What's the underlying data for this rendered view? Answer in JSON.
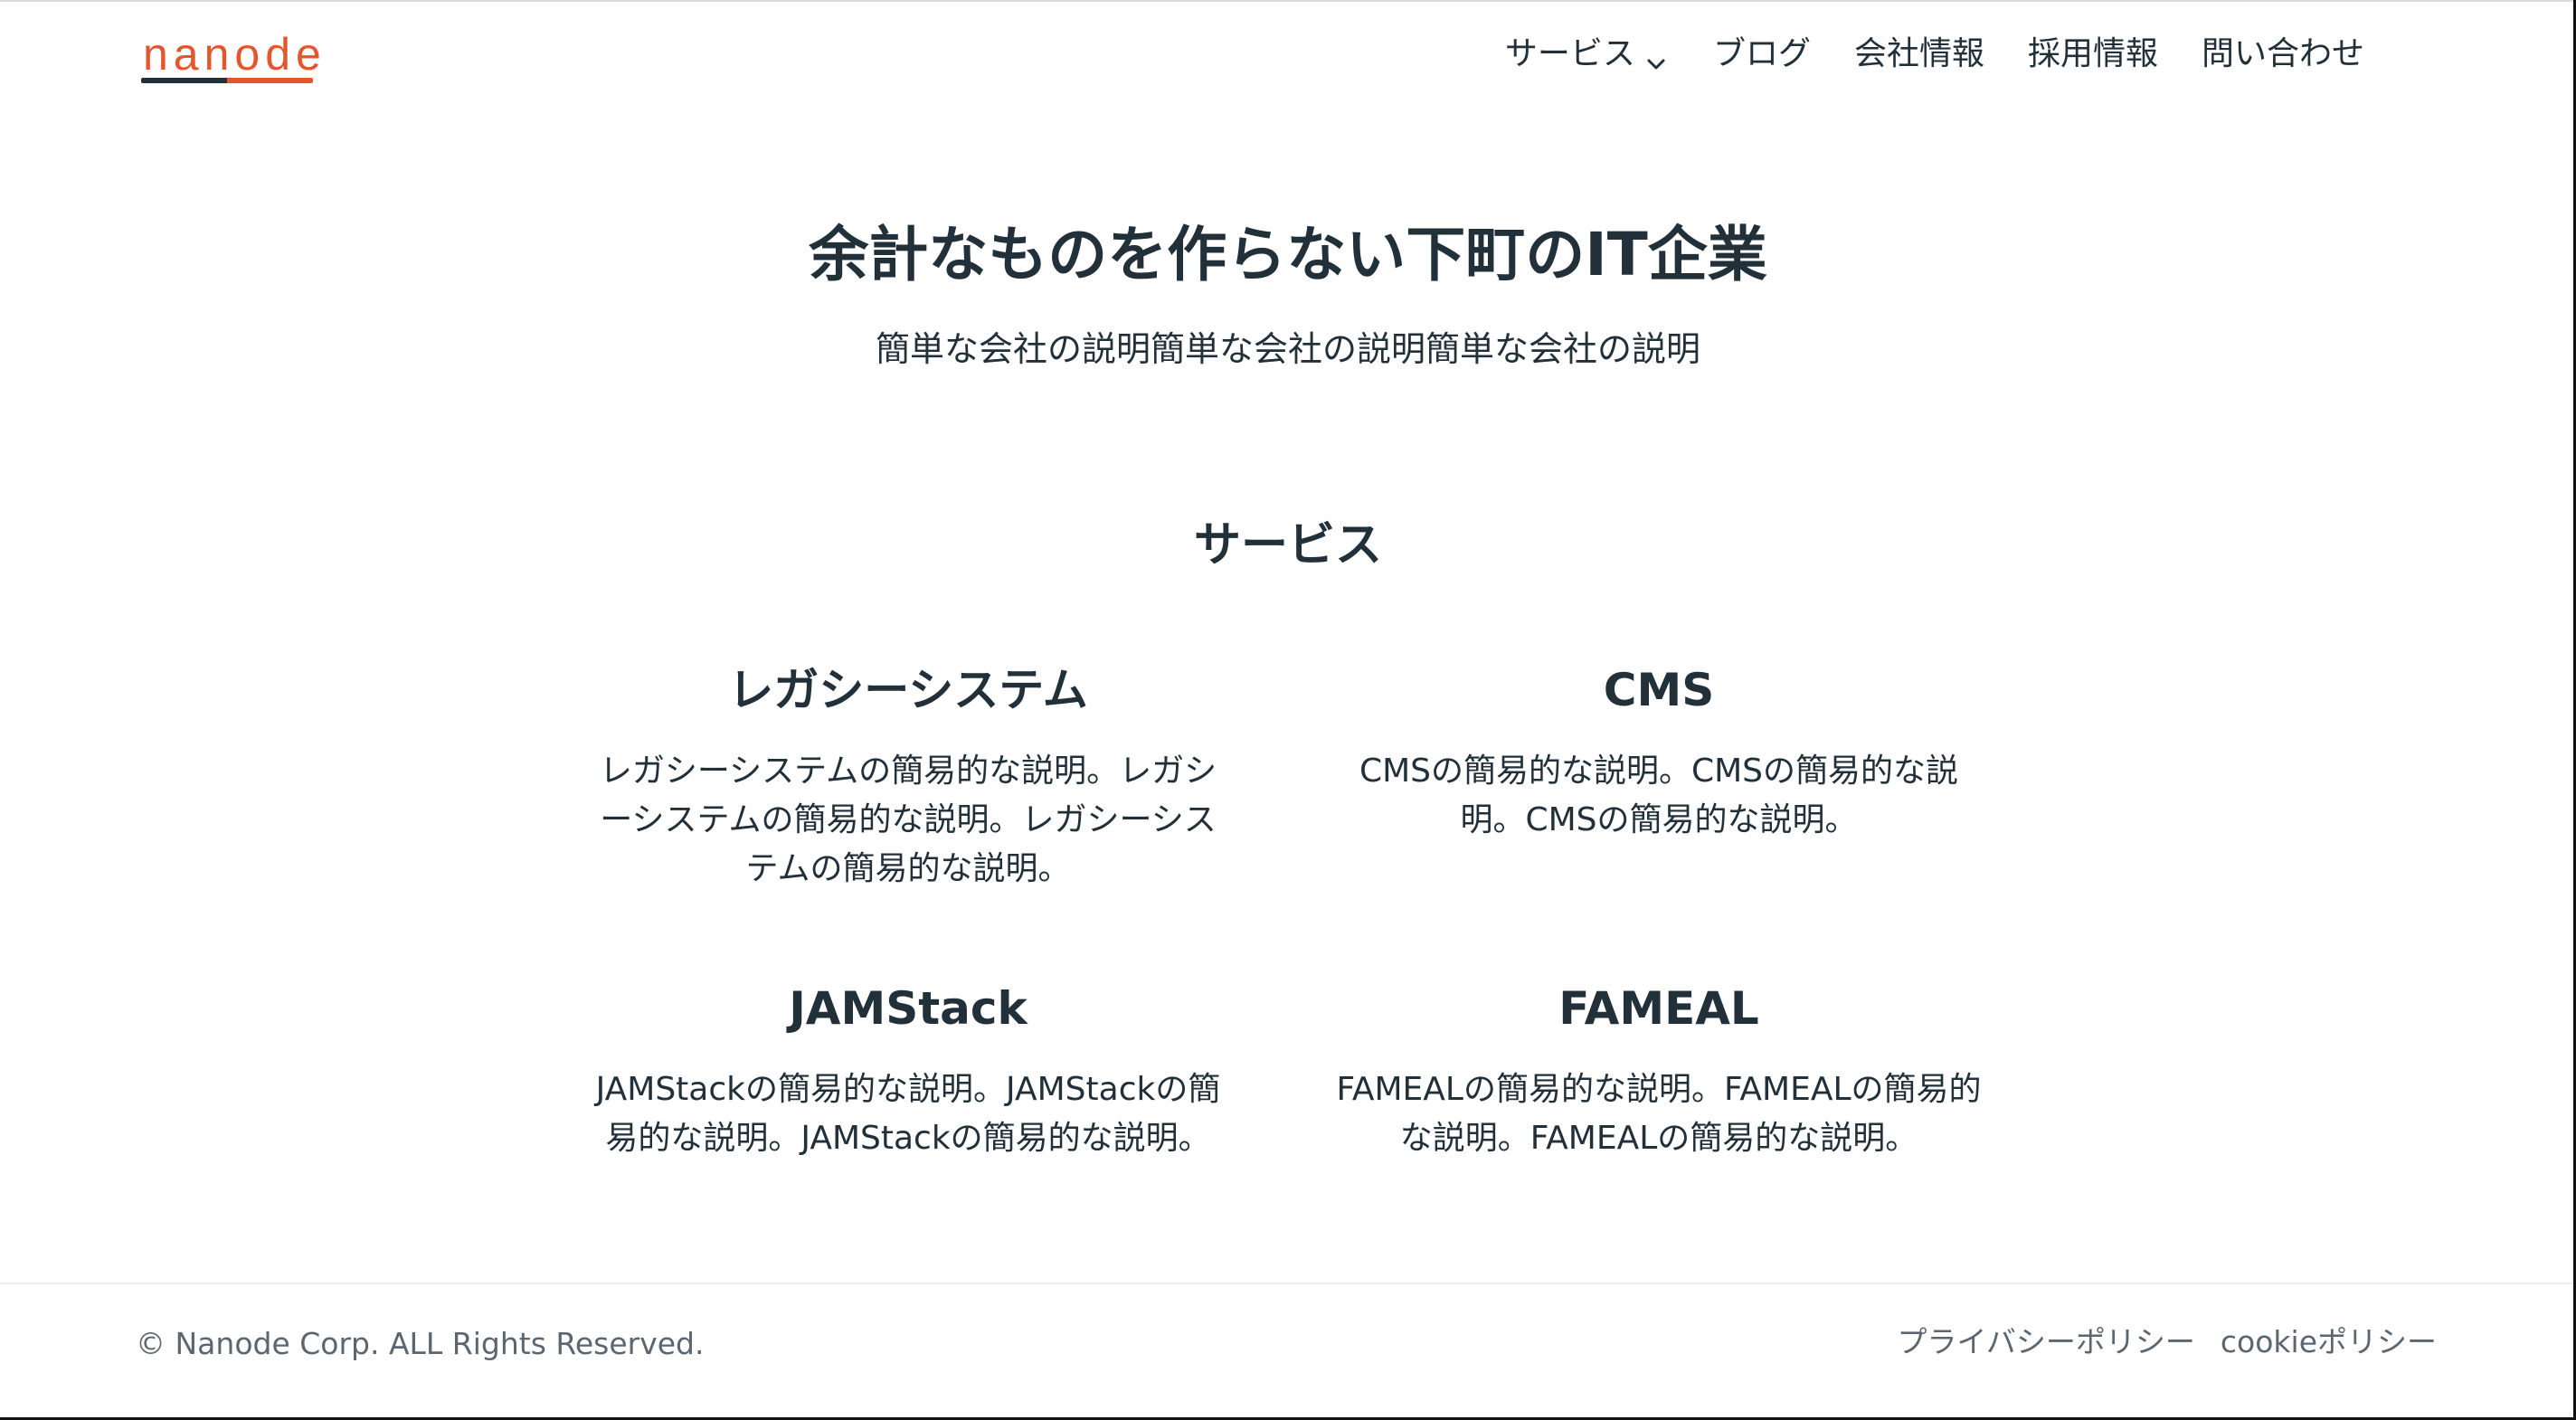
{
  "header": {
    "logo_text": "nanode",
    "nav": [
      {
        "label": "サービス",
        "has_dropdown": true
      },
      {
        "label": "ブログ"
      },
      {
        "label": "会社情報"
      },
      {
        "label": "採用情報"
      },
      {
        "label": "問い合わせ"
      }
    ]
  },
  "hero": {
    "title": "余計なものを作らない下町のIT企業",
    "subtitle": "簡単な会社の説明簡単な会社の説明簡単な会社の説明"
  },
  "services": {
    "title": "サービス",
    "items": [
      {
        "title": "レガシーシステム",
        "description": "レガシーシステムの簡易的な説明。レガシーシステムの簡易的な説明。レガシーシステムの簡易的な説明。"
      },
      {
        "title": "CMS",
        "description": "CMSの簡易的な説明。CMSの簡易的な説明。CMSの簡易的な説明。"
      },
      {
        "title": "JAMStack",
        "description": "JAMStackの簡易的な説明。JAMStackの簡易的な説明。JAMStackの簡易的な説明。"
      },
      {
        "title": "FAMEAL",
        "description": "FAMEALの簡易的な説明。FAMEALの簡易的な説明。FAMEALの簡易的な説明。"
      }
    ]
  },
  "footer": {
    "copyright": "© Nanode Corp. ALL Rights Reserved.",
    "links": [
      {
        "label": "プライバシーポリシー"
      },
      {
        "label": "cookieポリシー"
      }
    ]
  },
  "colors": {
    "brand": "#e4572e",
    "text": "#22303a",
    "muted": "#5b6670"
  },
  "icons": {
    "dropdown": "chevron-down-icon"
  }
}
